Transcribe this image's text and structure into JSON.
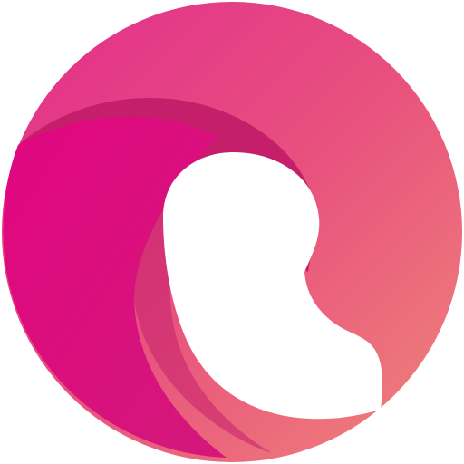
{
  "logo": {
    "icon": "wave-swirl-logo-icon",
    "colors": {
      "background": "#ffffff",
      "outer_light": "#ee7b7a",
      "outer_mid": "#e8507e",
      "outer_dark": "#e3338a",
      "wave_back": "#c51f6b",
      "wave_front_light": "#d4177a",
      "wave_front_dark": "#e0087f",
      "inner_fill": "#ffffff"
    }
  }
}
